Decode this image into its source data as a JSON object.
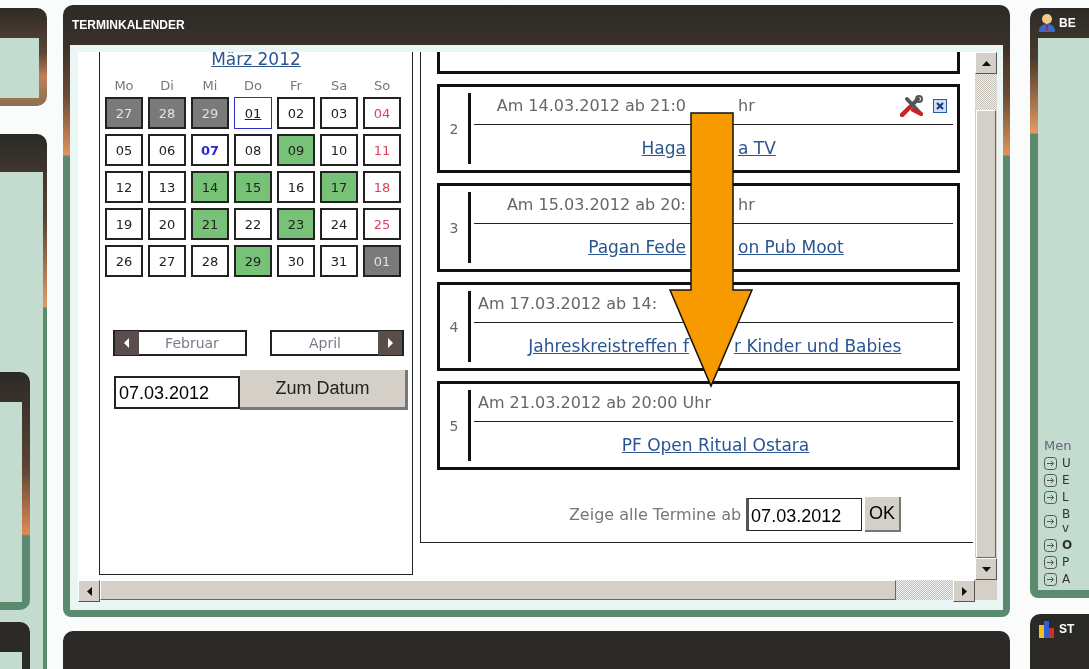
{
  "calendar_panel": {
    "title": "TERMINKALENDER",
    "month": {
      "title": "März 2012",
      "weekdays": [
        "Mo",
        "Di",
        "Mi",
        "Do",
        "Fr",
        "Sa",
        "So"
      ],
      "days": [
        {
          "label": "27",
          "kind": "outside",
          "has_event": false,
          "today": false,
          "focused": false
        },
        {
          "label": "28",
          "kind": "outside",
          "has_event": false,
          "today": false,
          "focused": false
        },
        {
          "label": "29",
          "kind": "outside",
          "has_event": false,
          "today": false,
          "focused": false
        },
        {
          "label": "01",
          "kind": "weekday",
          "has_event": false,
          "today": false,
          "focused": true
        },
        {
          "label": "02",
          "kind": "weekday",
          "has_event": false,
          "today": false,
          "focused": false
        },
        {
          "label": "03",
          "kind": "weekday",
          "has_event": false,
          "today": false,
          "focused": false
        },
        {
          "label": "04",
          "kind": "sunday",
          "has_event": false,
          "today": false,
          "focused": false
        },
        {
          "label": "05",
          "kind": "weekday",
          "has_event": false,
          "today": false,
          "focused": false
        },
        {
          "label": "06",
          "kind": "weekday",
          "has_event": false,
          "today": false,
          "focused": false
        },
        {
          "label": "07",
          "kind": "weekday",
          "has_event": false,
          "today": true,
          "focused": false
        },
        {
          "label": "08",
          "kind": "weekday",
          "has_event": false,
          "today": false,
          "focused": false
        },
        {
          "label": "09",
          "kind": "weekday",
          "has_event": true,
          "today": false,
          "focused": false
        },
        {
          "label": "10",
          "kind": "weekday",
          "has_event": false,
          "today": false,
          "focused": false
        },
        {
          "label": "11",
          "kind": "sunday",
          "has_event": false,
          "today": false,
          "focused": false
        },
        {
          "label": "12",
          "kind": "weekday",
          "has_event": false,
          "today": false,
          "focused": false
        },
        {
          "label": "13",
          "kind": "weekday",
          "has_event": false,
          "today": false,
          "focused": false
        },
        {
          "label": "14",
          "kind": "weekday",
          "has_event": true,
          "today": false,
          "focused": false
        },
        {
          "label": "15",
          "kind": "weekday",
          "has_event": true,
          "today": false,
          "focused": false
        },
        {
          "label": "16",
          "kind": "weekday",
          "has_event": false,
          "today": false,
          "focused": false
        },
        {
          "label": "17",
          "kind": "weekday",
          "has_event": true,
          "today": false,
          "focused": false
        },
        {
          "label": "18",
          "kind": "sunday",
          "has_event": false,
          "today": false,
          "focused": false
        },
        {
          "label": "19",
          "kind": "weekday",
          "has_event": false,
          "today": false,
          "focused": false
        },
        {
          "label": "20",
          "kind": "weekday",
          "has_event": false,
          "today": false,
          "focused": false
        },
        {
          "label": "21",
          "kind": "weekday",
          "has_event": true,
          "today": false,
          "focused": false
        },
        {
          "label": "22",
          "kind": "weekday",
          "has_event": false,
          "today": false,
          "focused": false
        },
        {
          "label": "23",
          "kind": "weekday",
          "has_event": true,
          "today": false,
          "focused": false
        },
        {
          "label": "24",
          "kind": "weekday",
          "has_event": false,
          "today": false,
          "focused": false
        },
        {
          "label": "25",
          "kind": "sunday",
          "has_event": false,
          "today": false,
          "focused": false
        },
        {
          "label": "26",
          "kind": "weekday",
          "has_event": false,
          "today": false,
          "focused": false
        },
        {
          "label": "27",
          "kind": "weekday",
          "has_event": false,
          "today": false,
          "focused": false
        },
        {
          "label": "28",
          "kind": "weekday",
          "has_event": false,
          "today": false,
          "focused": false
        },
        {
          "label": "29",
          "kind": "weekday",
          "has_event": true,
          "today": false,
          "focused": false
        },
        {
          "label": "30",
          "kind": "weekday",
          "has_event": false,
          "today": false,
          "focused": false
        },
        {
          "label": "31",
          "kind": "weekday",
          "has_event": false,
          "today": false,
          "focused": false
        },
        {
          "label": "01",
          "kind": "outside",
          "has_event": false,
          "today": false,
          "focused": false
        }
      ],
      "prev_button": "Februar",
      "next_button": "April",
      "date_field": "07.03.2012",
      "goto_button": "Zum Datum"
    },
    "events": [
      {
        "number": "2",
        "when": [
          "Am 14.03.2012 ab 21:0",
          "hr"
        ],
        "title": [
          "Haga",
          "a TV"
        ],
        "editable": true
      },
      {
        "number": "3",
        "when": [
          "Am 15.03.2012 ab 20:",
          "hr"
        ],
        "title": [
          "Pagan Fede",
          "on Pub Moot"
        ],
        "editable": false
      },
      {
        "number": "4",
        "when": [
          "Am 17.03.2012 ab 14:"
        ],
        "title": [
          "Jahreskreistreffen f",
          "r Kinder und Babies"
        ],
        "editable": false
      },
      {
        "number": "5",
        "when": [
          "Am 21.03.2012 ab 20:00 Uhr"
        ],
        "title": [
          "PF Open Ritual Ostara"
        ],
        "editable": false
      }
    ],
    "filter": {
      "label": "Zeige alle Termine ab",
      "date_field": "07.03.2012",
      "ok_button": "OK"
    }
  },
  "user_panel": {
    "title": "BE",
    "menu_heading": "Men",
    "menu_items": [
      {
        "label": "U",
        "current": false
      },
      {
        "label": "E",
        "current": false
      },
      {
        "label": "L",
        "current": false
      },
      {
        "label": "B v",
        "current": false
      },
      {
        "label": "O",
        "current": true
      },
      {
        "label": "P",
        "current": false
      },
      {
        "label": "A",
        "current": false
      }
    ]
  },
  "stats_panel": {
    "title": "ST"
  }
}
